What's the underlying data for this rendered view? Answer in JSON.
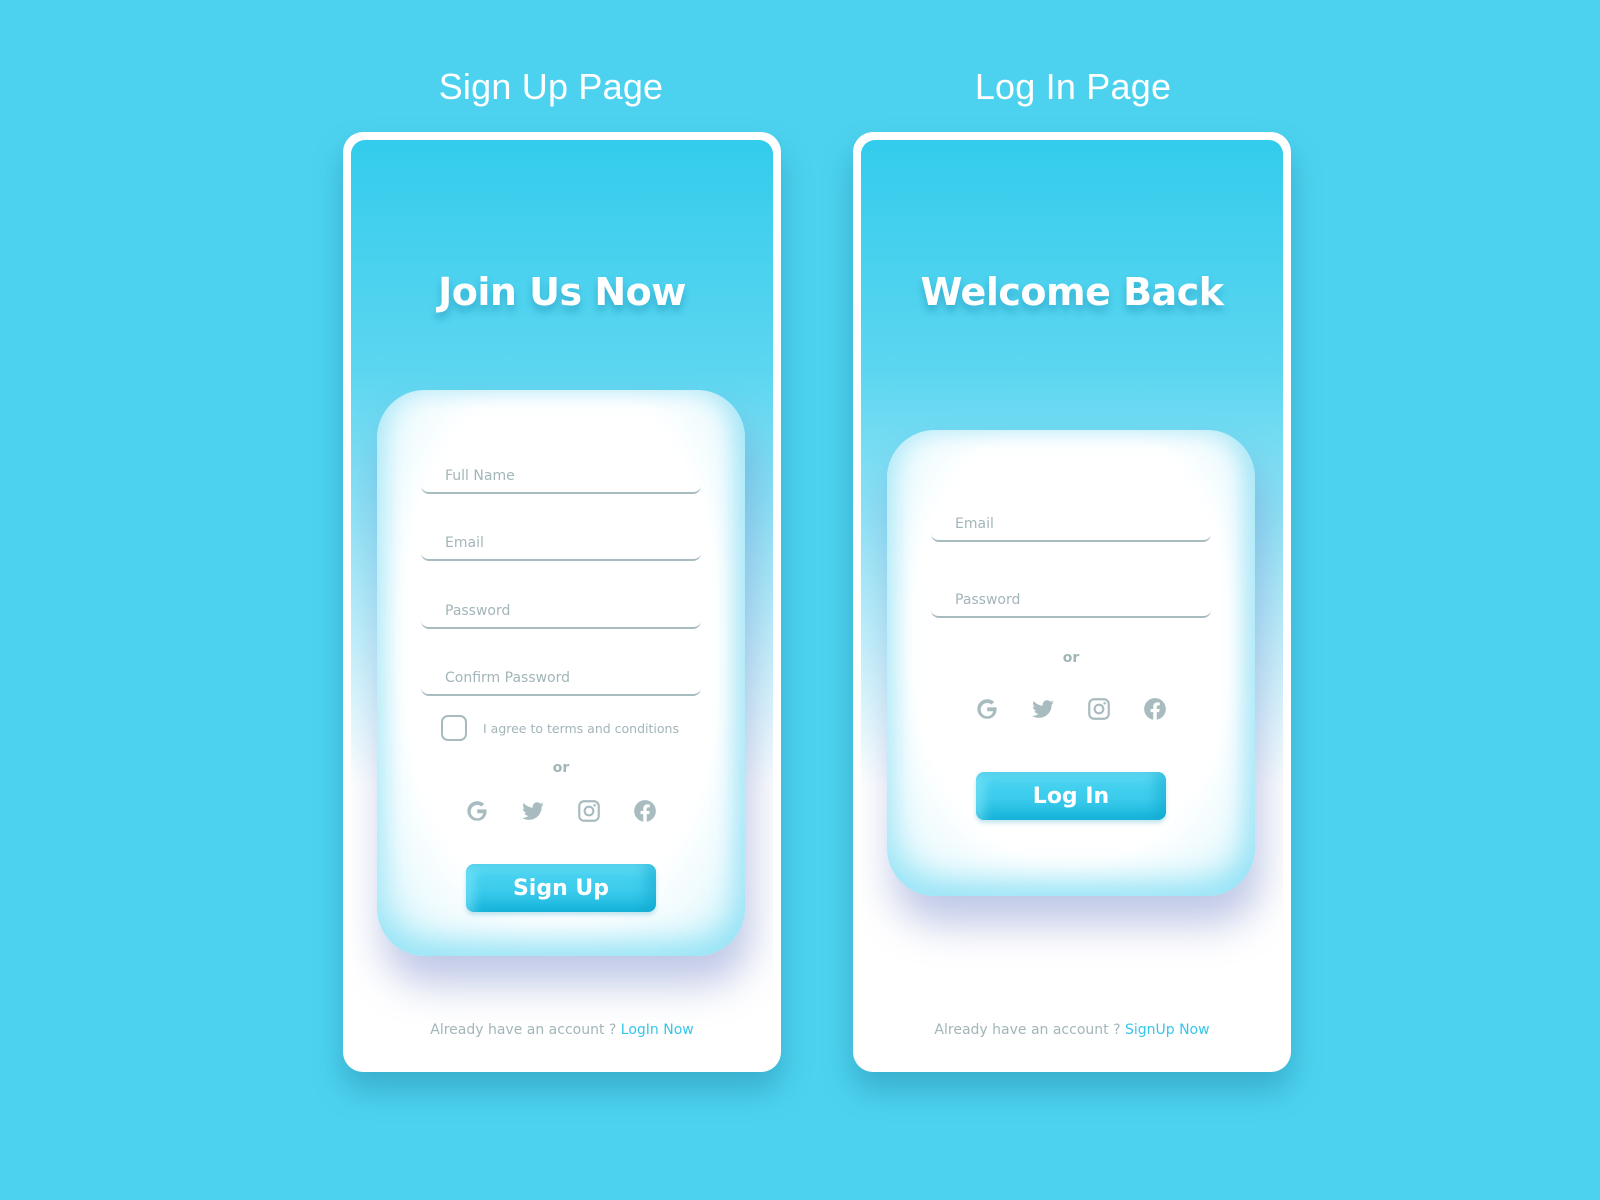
{
  "colors": {
    "background": "#4cd2ef",
    "accent": "#35c6ea",
    "muted": "#a2b5b9"
  },
  "signup": {
    "page_label": "Sign Up Page",
    "headline": "Join Us Now",
    "fields": {
      "full_name_placeholder": "Full Name",
      "email_placeholder": "Email",
      "password_placeholder": "Password",
      "confirm_password_placeholder": "Confirm Password"
    },
    "terms_label": "I agree to terms and conditions",
    "terms_checked": false,
    "or_label": "or",
    "social_icons": [
      "google-icon",
      "twitter-icon",
      "instagram-icon",
      "facebook-icon"
    ],
    "submit_label": "Sign Up",
    "footer_text": "Already have an account ? ",
    "footer_link": "LogIn Now"
  },
  "login": {
    "page_label": "Log In Page",
    "headline": "Welcome Back",
    "fields": {
      "email_placeholder": "Email",
      "password_placeholder": "Password"
    },
    "or_label": "or",
    "social_icons": [
      "google-icon",
      "twitter-icon",
      "instagram-icon",
      "facebook-icon"
    ],
    "submit_label": "Log In",
    "footer_text": "Already have an account ? ",
    "footer_link": "SignUp Now"
  }
}
